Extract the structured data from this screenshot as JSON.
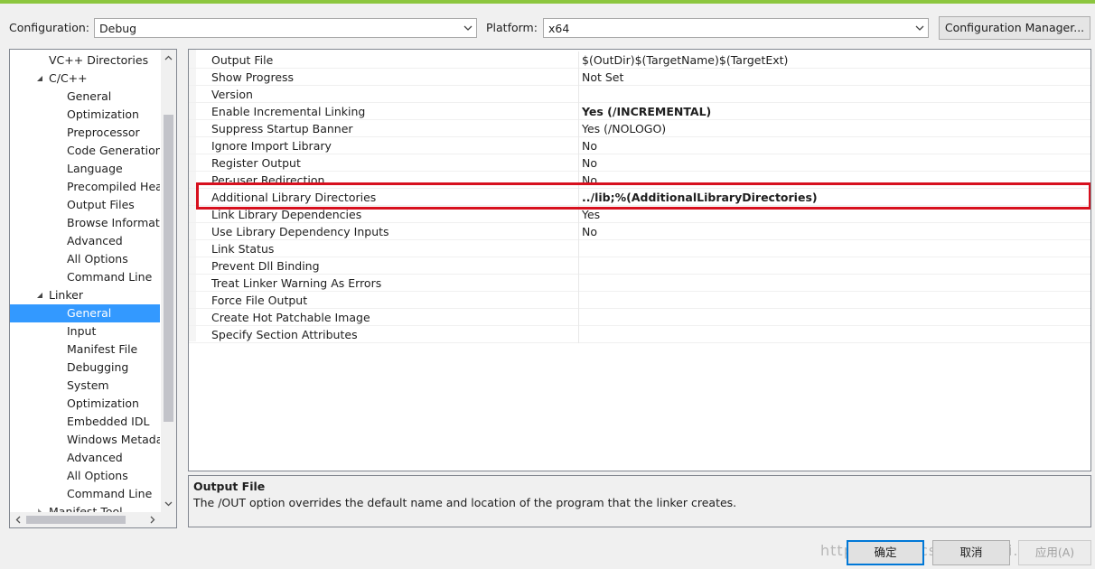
{
  "toolbar": {
    "configuration_label": "Configuration:",
    "configuration_value": "Debug",
    "platform_label": "Platform:",
    "platform_value": "x64",
    "config_manager_label": "Configuration Manager..."
  },
  "tree": {
    "items": [
      {
        "label": "VC++ Directories",
        "level": 1
      },
      {
        "label": "C/C++",
        "level": 1,
        "expanded": true
      },
      {
        "label": "General",
        "level": 2
      },
      {
        "label": "Optimization",
        "level": 2
      },
      {
        "label": "Preprocessor",
        "level": 2
      },
      {
        "label": "Code Generation",
        "level": 2
      },
      {
        "label": "Language",
        "level": 2
      },
      {
        "label": "Precompiled Headers",
        "level": 2
      },
      {
        "label": "Output Files",
        "level": 2
      },
      {
        "label": "Browse Information",
        "level": 2
      },
      {
        "label": "Advanced",
        "level": 2
      },
      {
        "label": "All Options",
        "level": 2
      },
      {
        "label": "Command Line",
        "level": 2
      },
      {
        "label": "Linker",
        "level": 1,
        "expanded": true
      },
      {
        "label": "General",
        "level": 2,
        "selected": true
      },
      {
        "label": "Input",
        "level": 2
      },
      {
        "label": "Manifest File",
        "level": 2
      },
      {
        "label": "Debugging",
        "level": 2
      },
      {
        "label": "System",
        "level": 2
      },
      {
        "label": "Optimization",
        "level": 2
      },
      {
        "label": "Embedded IDL",
        "level": 2
      },
      {
        "label": "Windows Metadata",
        "level": 2
      },
      {
        "label": "Advanced",
        "level": 2
      },
      {
        "label": "All Options",
        "level": 2
      },
      {
        "label": "Command Line",
        "level": 2
      },
      {
        "label": "Manifest Tool",
        "level": 1,
        "expanded": false
      }
    ]
  },
  "properties": [
    {
      "name": "Output File",
      "value": "$(OutDir)$(TargetName)$(TargetExt)",
      "bold": false
    },
    {
      "name": "Show Progress",
      "value": "Not Set",
      "bold": false
    },
    {
      "name": "Version",
      "value": "",
      "bold": false
    },
    {
      "name": "Enable Incremental Linking",
      "value": "Yes (/INCREMENTAL)",
      "bold": true
    },
    {
      "name": "Suppress Startup Banner",
      "value": "Yes (/NOLOGO)",
      "bold": false
    },
    {
      "name": "Ignore Import Library",
      "value": "No",
      "bold": false
    },
    {
      "name": "Register Output",
      "value": "No",
      "bold": false
    },
    {
      "name": "Per-user Redirection",
      "value": "No",
      "bold": false
    },
    {
      "name": "Additional Library Directories",
      "value": "../lib;%(AdditionalLibraryDirectories)",
      "bold": true
    },
    {
      "name": "Link Library Dependencies",
      "value": "Yes",
      "bold": false
    },
    {
      "name": "Use Library Dependency Inputs",
      "value": "No",
      "bold": false
    },
    {
      "name": "Link Status",
      "value": "",
      "bold": false
    },
    {
      "name": "Prevent Dll Binding",
      "value": "",
      "bold": false
    },
    {
      "name": "Treat Linker Warning As Errors",
      "value": "",
      "bold": false
    },
    {
      "name": "Force File Output",
      "value": "",
      "bold": false
    },
    {
      "name": "Create Hot Patchable Image",
      "value": "",
      "bold": false
    },
    {
      "name": "Specify Section Attributes",
      "value": "",
      "bold": false
    }
  ],
  "description": {
    "title": "Output File",
    "text": "The /OUT option overrides the default name and location of the program that the linker creates."
  },
  "buttons": {
    "ok": "确定",
    "cancel": "取消",
    "apply": "应用(A)"
  },
  "watermark": "https://blog.csdn.net/Mi..."
}
